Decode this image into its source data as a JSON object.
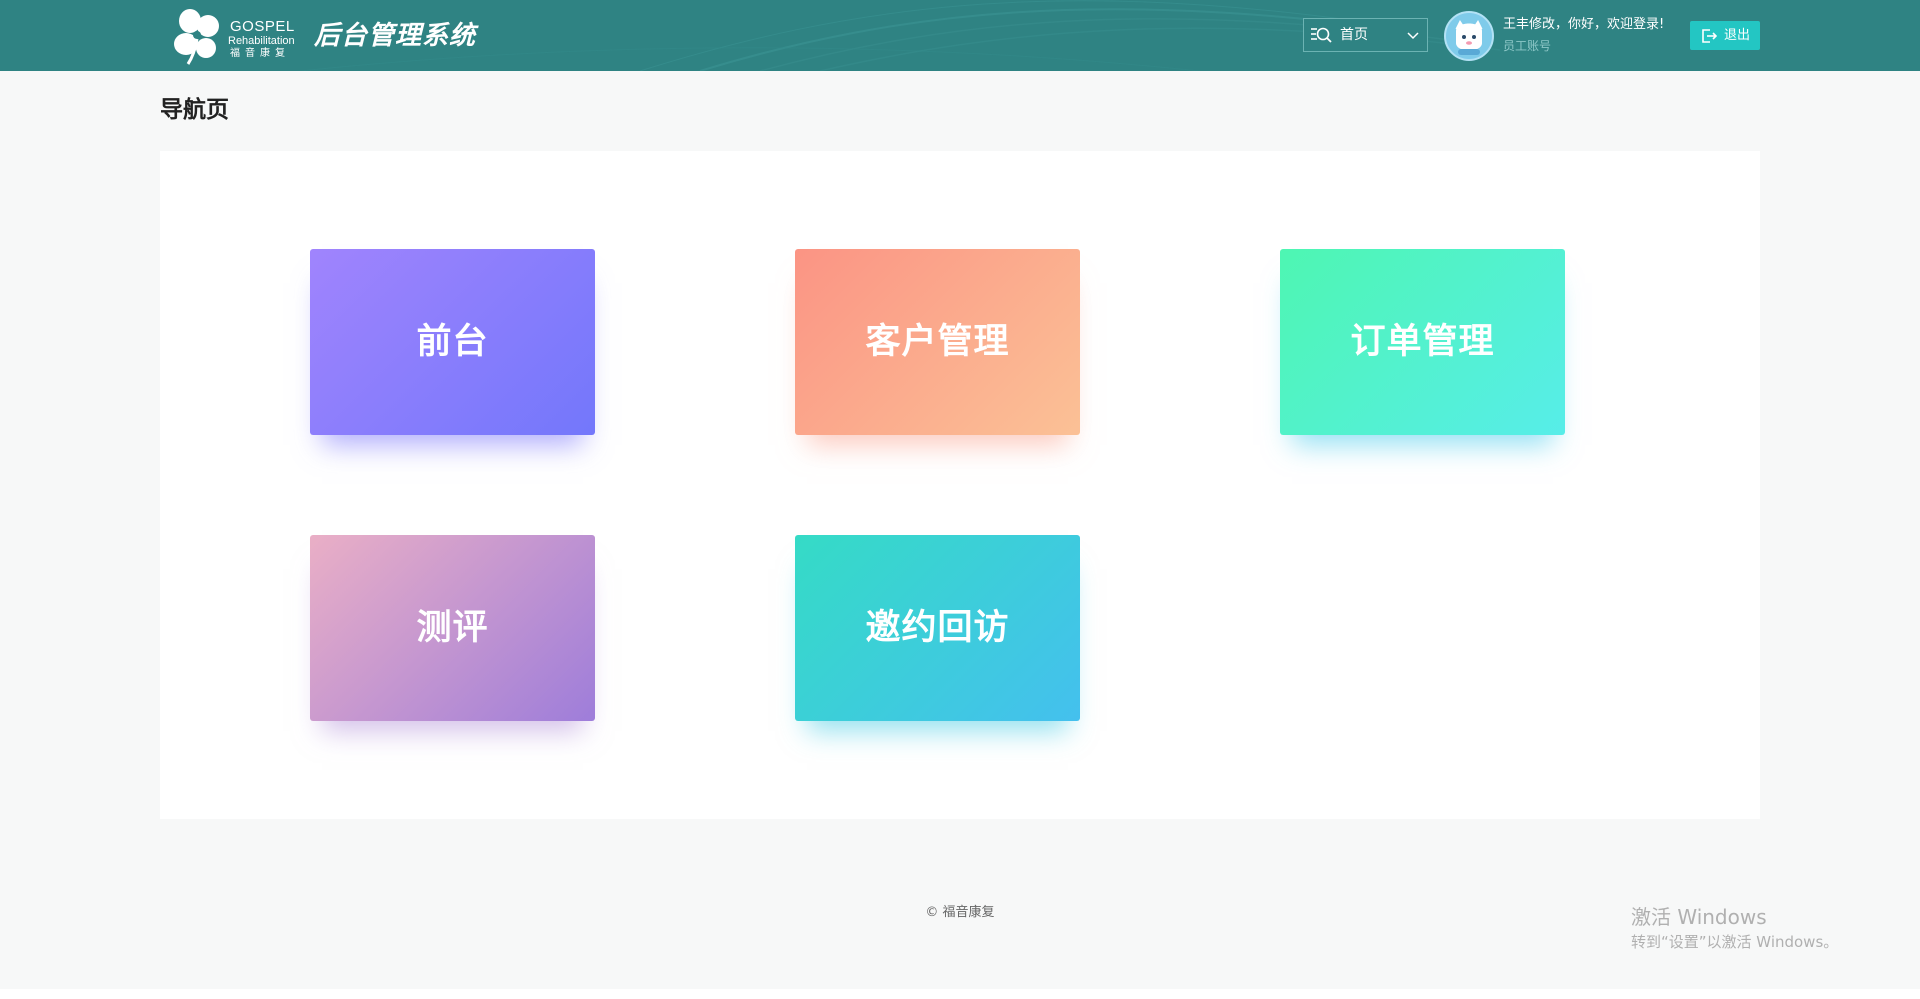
{
  "header": {
    "logo": {
      "brand_en": "GOSPEL",
      "brand_en2": "Rehabilitation",
      "brand_cn": "福音康复"
    },
    "system_title": "后台管理系统",
    "nav_select": {
      "value": "首页",
      "icon": "search-list-icon"
    },
    "user": {
      "greeting": "王丰修改，你好，欢迎登录!",
      "role": "员工账号"
    },
    "logout_label": "退出",
    "colors": {
      "bar": "#2f8383",
      "logout": "#23c6c3"
    }
  },
  "main": {
    "title": "导航页",
    "tiles": [
      {
        "label": "前台"
      },
      {
        "label": "客户管理"
      },
      {
        "label": "订单管理"
      },
      {
        "label": "测评"
      },
      {
        "label": "邀约回访"
      }
    ]
  },
  "footer": {
    "copyright": "© 福音康复"
  },
  "watermark": {
    "line1": "激活 Windows",
    "line2": "转到“设置”以激活 Windows。"
  }
}
